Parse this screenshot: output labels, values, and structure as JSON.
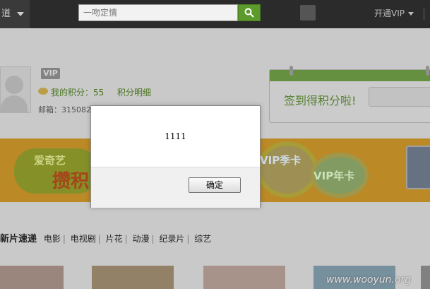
{
  "topbar": {
    "channel_label": "道",
    "search_placeholder": "一吻定情",
    "open_vip_label": "开通VIP"
  },
  "profile": {
    "vip_badge": "VIP",
    "points_label": "我的积分：55",
    "points_detail_label": "积分明细",
    "email_label": "邮箱：315082"
  },
  "signin": {
    "text": "签到得积分啦!"
  },
  "banner": {
    "brand_text": "爱奇艺",
    "headline_text": "攒积",
    "card1_text": "VIP季卡",
    "card2_text": "VIP年卡"
  },
  "nav": {
    "title": "新片速递",
    "items": [
      "电影",
      "电视剧",
      "片花",
      "动漫",
      "纪录片",
      "综艺"
    ]
  },
  "dialog": {
    "message": "1111",
    "ok_label": "确定"
  },
  "watermark": "www.wooyun.org",
  "colors": {
    "topbar": "#2b2b2b",
    "accent_green": "#5c9a2c",
    "dialog_bg": "#ffffff",
    "dialog_footer": "#f0f0f0"
  }
}
